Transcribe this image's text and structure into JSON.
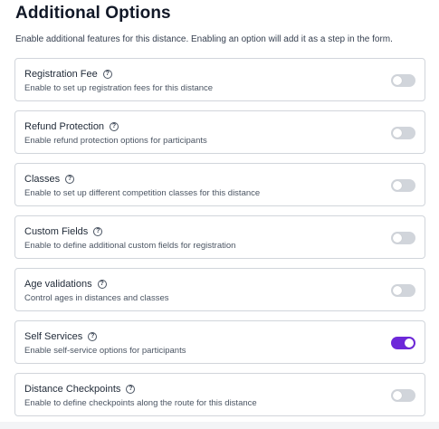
{
  "header": {
    "title": "Additional Options",
    "description": "Enable additional features for this distance. Enabling an option will add it as a step in the form."
  },
  "help_icon": "?",
  "accent_color": "#6d28d9",
  "options": [
    {
      "title": "Registration Fee",
      "description": "Enable to set up registration fees for this distance",
      "enabled": false
    },
    {
      "title": "Refund Protection",
      "description": "Enable refund protection options for participants",
      "enabled": false
    },
    {
      "title": "Classes",
      "description": "Enable to set up different competition classes for this distance",
      "enabled": false
    },
    {
      "title": "Custom Fields",
      "description": "Enable to define additional custom fields for registration",
      "enabled": false
    },
    {
      "title": "Age validations",
      "description": "Control ages in distances and classes",
      "enabled": false
    },
    {
      "title": "Self Services",
      "description": "Enable self-service options for participants",
      "enabled": true
    },
    {
      "title": "Distance Checkpoints",
      "description": "Enable to define checkpoints along the route for this distance",
      "enabled": false
    }
  ]
}
